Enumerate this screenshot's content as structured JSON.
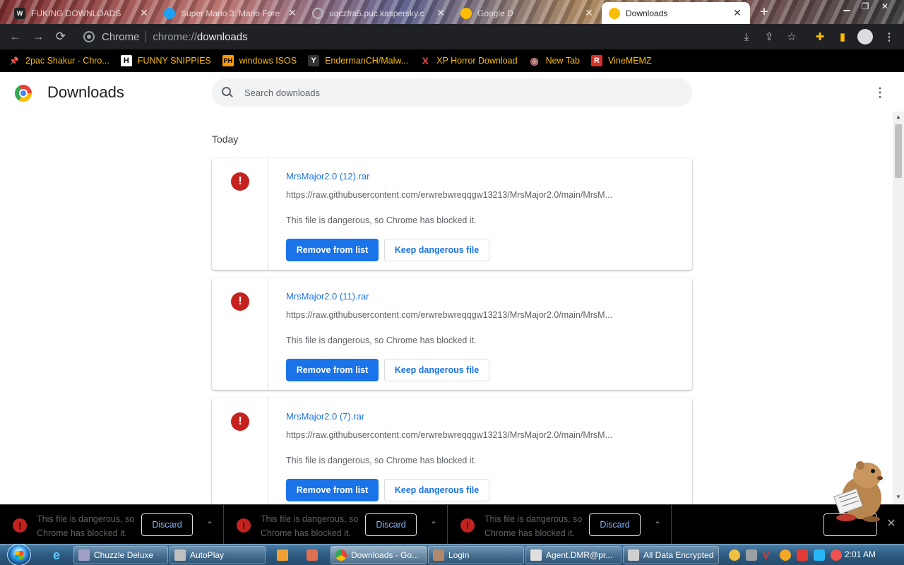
{
  "browser": {
    "tabs": [
      {
        "title": "FUKING DOWNLOADS",
        "active": false,
        "favicon_color": "#222222"
      },
      {
        "title": "Super Mario 3: Mario Fore",
        "active": false,
        "favicon_color": "#1da1f2"
      },
      {
        "title": "uqczfra5.puc.kaspersky.c",
        "active": false,
        "favicon_color": "#777777"
      },
      {
        "title": "Google D",
        "active": false,
        "favicon_color": "#fbbc04"
      },
      {
        "title": "Downloads",
        "active": true,
        "favicon_color": "#fbbc04"
      }
    ],
    "new_tab_label": "+",
    "omnibox": {
      "chip": "Chrome",
      "scheme": "chrome://",
      "host": "downloads"
    }
  },
  "bookmarks": [
    {
      "label": "2pac Shakur - Chro...",
      "icon": "pushpin-icon",
      "icon_text": "📌",
      "icon_bg": "transparent",
      "icon_color": "#ea4335"
    },
    {
      "label": "FUNNY SNIPPIES",
      "icon": "h-icon",
      "icon_text": "H",
      "icon_bg": "#ffffff",
      "icon_color": "#000000"
    },
    {
      "label": "windows ISOS",
      "icon": "ph-icon",
      "icon_text": "PH",
      "icon_bg": "#ff9900",
      "icon_color": "#000000"
    },
    {
      "label": "EndermanCH/Malw...",
      "icon": "y-icon",
      "icon_text": "Y",
      "icon_bg": "#333333",
      "icon_color": "#ffffff"
    },
    {
      "label": "XP Horror Download",
      "icon": "x-icon",
      "icon_text": "X",
      "icon_bg": "transparent",
      "icon_color": "#ea4335"
    },
    {
      "label": "New Tab",
      "icon": "globe-icon",
      "icon_text": "◉",
      "icon_bg": "transparent",
      "icon_color": "#c98a8a"
    },
    {
      "label": "VineMEMZ",
      "icon": "r-icon",
      "icon_text": "R",
      "icon_bg": "#d93025",
      "icon_color": "#ffffff"
    }
  ],
  "page": {
    "title": "Downloads",
    "search_placeholder": "Search downloads",
    "section_label": "Today",
    "items": [
      {
        "file_name": "MrsMajor2.0 (12).rar",
        "url": "https://raw.githubusercontent.com/erwrebwreqqgw13213/MrsMajor2.0/main/MrsM...",
        "description": "This file is dangerous, so Chrome has blocked it.",
        "primary_action": "Remove from list",
        "secondary_action": "Keep dangerous file"
      },
      {
        "file_name": "MrsMajor2.0 (11).rar",
        "url": "https://raw.githubusercontent.com/erwrebwreqqgw13213/MrsMajor2.0/main/MrsM...",
        "description": "This file is dangerous, so Chrome has blocked it.",
        "primary_action": "Remove from list",
        "secondary_action": "Keep dangerous file"
      },
      {
        "file_name": "MrsMajor2.0 (7).rar",
        "url": "https://raw.githubusercontent.com/erwrebwreqqgw13213/MrsMajor2.0/main/MrsM...",
        "description": "This file is dangerous, so Chrome has blocked it.",
        "primary_action": "Remove from list",
        "secondary_action": "Keep dangerous file"
      }
    ]
  },
  "shelf": {
    "items": [
      {
        "text": "This file is dangerous, so Chrome has blocked it.",
        "action": "Discard"
      },
      {
        "text": "This file is dangerous, so Chrome has blocked it.",
        "action": "Discard"
      },
      {
        "text": "This file is dangerous, so Chrome has blocked it.",
        "action": "Discard"
      }
    ]
  },
  "taskbar": {
    "tasks": [
      {
        "label": "Chuzzle Deluxe",
        "icon_color": "#a0a0c8",
        "active": false
      },
      {
        "label": "AutoPlay",
        "icon_color": "#c0c0c0",
        "active": false
      },
      {
        "label": "Downloads - Go...",
        "icon_color": "#fbbc04",
        "active": true
      },
      {
        "label": "Login",
        "icon_color": "#b08a6a",
        "active": false
      },
      {
        "label": "Agent.DMR@pr...",
        "icon_color": "#e0e0e0",
        "active": false
      },
      {
        "label": "All Data Encrypted",
        "icon_color": "#d0d0d0",
        "active": false
      }
    ],
    "clock": "2:01 AM"
  },
  "colors": {
    "accent": "#1a73e8",
    "danger": "#c5221f"
  }
}
